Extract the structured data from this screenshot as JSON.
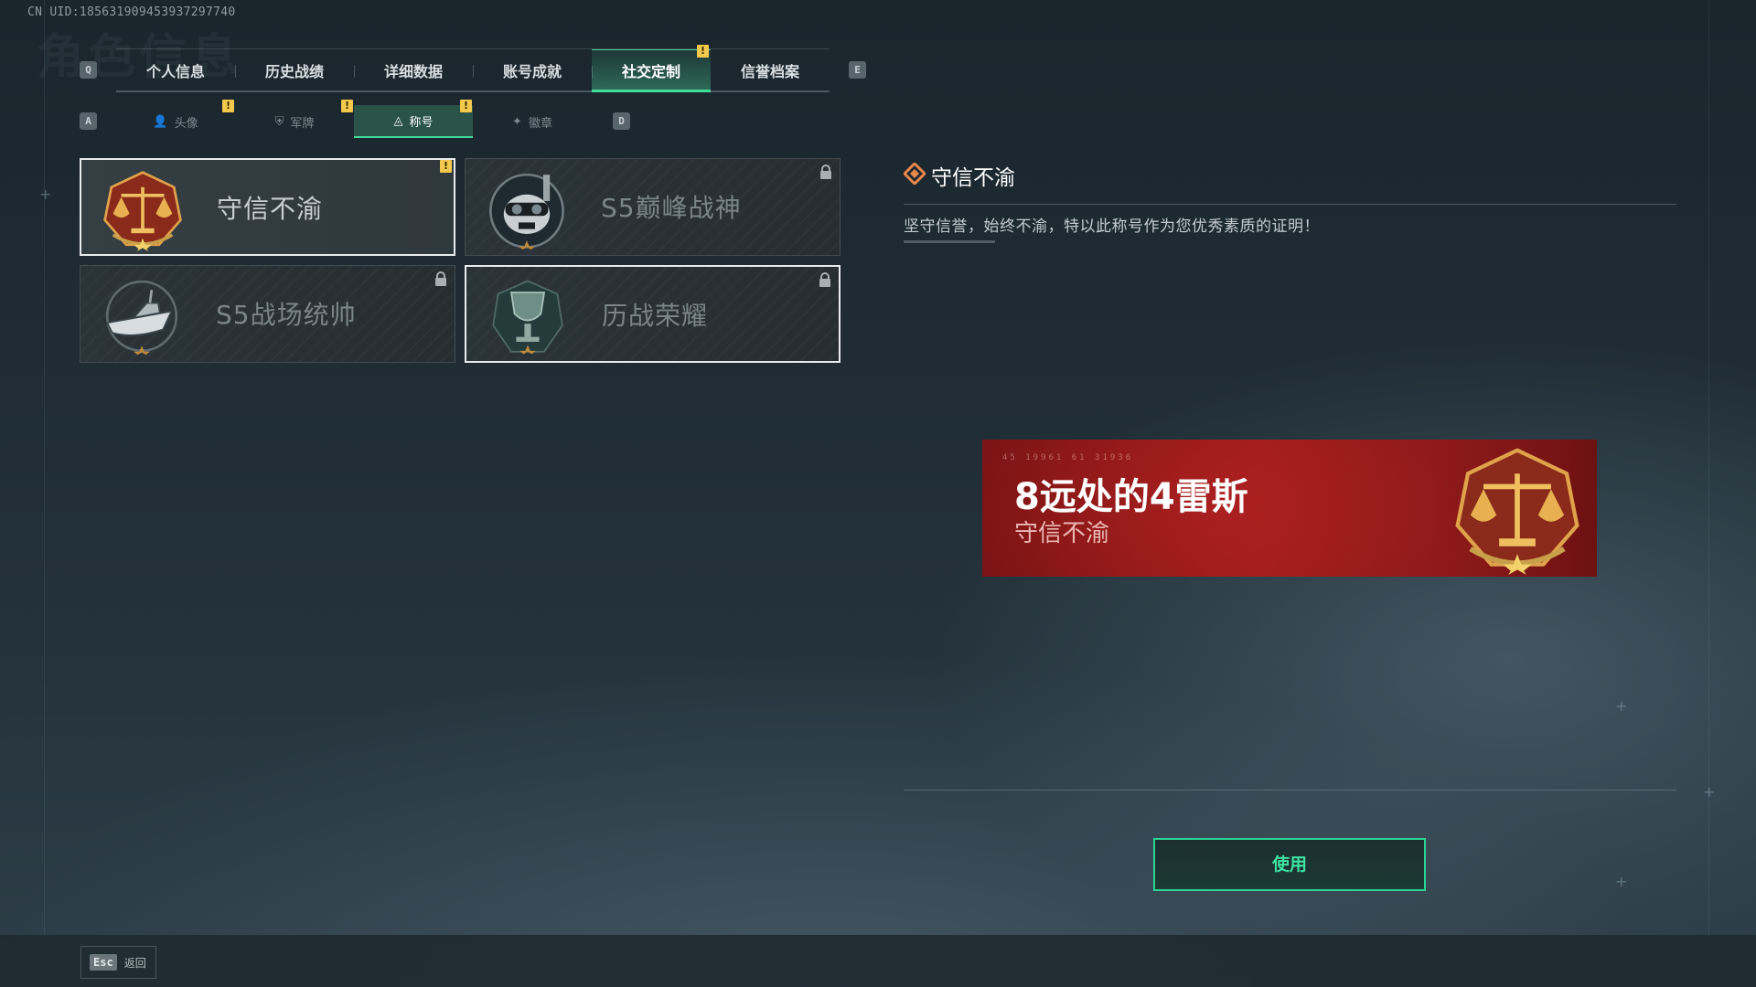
{
  "uid_text": "CN UID:1856319094539372977​40",
  "page_ghost_title": "角色信息",
  "keys": {
    "left": "Q",
    "right": "E",
    "sub_left": "A",
    "sub_right": "D"
  },
  "tabs": [
    {
      "label": "个人信息",
      "active": false
    },
    {
      "label": "历史战绩",
      "active": false
    },
    {
      "label": "详细数据",
      "active": false
    },
    {
      "label": "账号成就",
      "active": false
    },
    {
      "label": "社交定制",
      "active": true,
      "alert": "!"
    },
    {
      "label": "信誉档案",
      "active": false
    }
  ],
  "subtabs": [
    {
      "label": "头像",
      "icon": "person-icon",
      "glyph": "👤",
      "alert": "!"
    },
    {
      "label": "军牌",
      "icon": "dogtag-icon",
      "glyph": "⛨",
      "alert": "!"
    },
    {
      "label": "称号",
      "icon": "title-icon",
      "glyph": "◬",
      "alert": "!",
      "active": true
    },
    {
      "label": "徽章",
      "icon": "badge-icon",
      "glyph": "✦"
    }
  ],
  "cards": [
    {
      "title": "守信不渝",
      "emblem": "scales-emblem-icon",
      "selected": true,
      "locked": false,
      "alert": "!"
    },
    {
      "title": "S5巅峰战神",
      "emblem": "skull-diver-emblem-icon",
      "selected": false,
      "locked": true
    },
    {
      "title": "S5战场统帅",
      "emblem": "boat-emblem-icon",
      "selected": false,
      "locked": true
    },
    {
      "title": "历战荣耀",
      "emblem": "trophy-emblem-icon",
      "selected": false,
      "locked": true
    }
  ],
  "detail": {
    "title": "守信不渝",
    "description": "坚守信誉，始终不渝，特以此称号作为您优秀素质的证明！"
  },
  "banner": {
    "player_name": "8远处的4雷斯",
    "title": "守信不渝",
    "code": "45 19961 61 31936"
  },
  "use_button": "使用",
  "footer": {
    "esc_key": "Esc",
    "back_label": "返回"
  },
  "colors": {
    "accent": "#3fdc9b",
    "alert": "#f2c94c",
    "banner_red": "#a01c1c"
  }
}
